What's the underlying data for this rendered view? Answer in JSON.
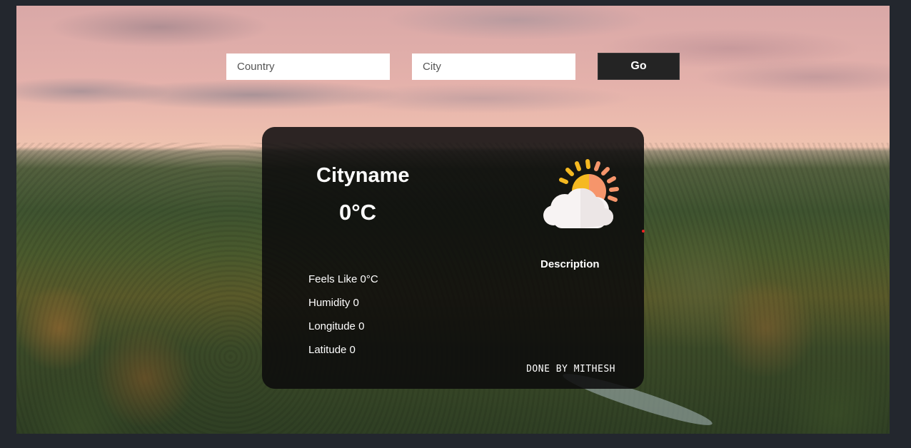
{
  "search": {
    "country_placeholder": "Country",
    "city_placeholder": "City",
    "go_label": "Go"
  },
  "card": {
    "city_name": "Cityname",
    "temperature": "0°C",
    "feels_like": "Feels Like 0°C",
    "humidity": "Humidity 0",
    "longitude": "Longitude 0",
    "latitude": "Latitude 0",
    "description": "Description",
    "credit": "DONE BY MITHESH",
    "icon": "partly-cloudy-icon"
  },
  "colors": {
    "page_bg": "#23272e",
    "card_bg": "rgba(12,10,12,0.86)",
    "go_button": "#242424",
    "sun_yellow": "#f5b921",
    "sun_orange": "#f6956b",
    "cloud": "#f7f3f3"
  }
}
